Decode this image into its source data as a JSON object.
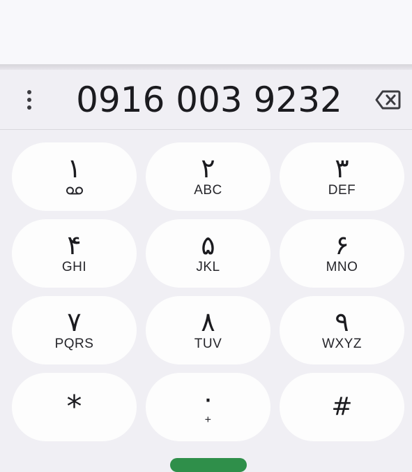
{
  "dialer": {
    "number": "0916 003 9232",
    "keys": [
      {
        "digit": "۱",
        "sub": ""
      },
      {
        "digit": "۲",
        "sub": "ABC"
      },
      {
        "digit": "۳",
        "sub": "DEF"
      },
      {
        "digit": "۴",
        "sub": "GHI"
      },
      {
        "digit": "۵",
        "sub": "JKL"
      },
      {
        "digit": "۶",
        "sub": "MNO"
      },
      {
        "digit": "۷",
        "sub": "PQRS"
      },
      {
        "digit": "۸",
        "sub": "TUV"
      },
      {
        "digit": "۹",
        "sub": "WXYZ"
      },
      {
        "digit": "*",
        "sub": ""
      },
      {
        "digit": "۰",
        "sub": "+"
      },
      {
        "digit": "#",
        "sub": ""
      }
    ]
  },
  "icons": {
    "menu": "more-vert-icon",
    "backspace": "backspace-icon",
    "voicemail": "voicemail-icon"
  },
  "colors": {
    "background": "#f0eff4",
    "key": "#fdfdfd",
    "text": "#1b1b1f",
    "call_button": "#2f8f4a"
  }
}
